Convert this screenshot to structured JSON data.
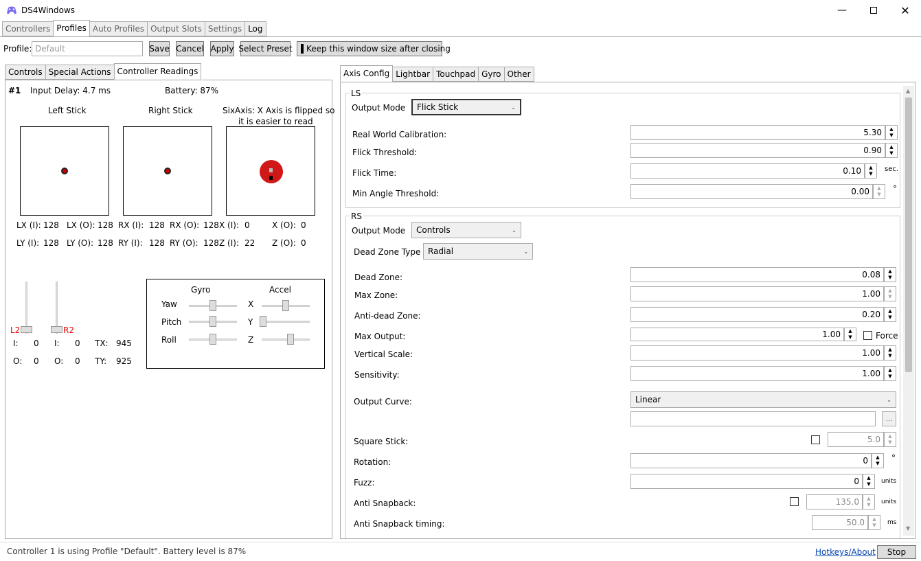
{
  "window": {
    "title": "DS4Windows",
    "min_icon": "minimize-icon",
    "max_icon": "maximize-icon",
    "close_icon": "close-icon"
  },
  "main_tabs": [
    "Controllers",
    "Profiles",
    "Auto Profiles",
    "Output Slots",
    "Settings",
    "Log"
  ],
  "toolbar": {
    "profile_label": "Profile:",
    "profile_placeholder": "Default",
    "save": "Save",
    "cancel": "Cancel",
    "apply": "Apply",
    "select_preset": "Select Preset",
    "keep_size": "Keep this window size after closing"
  },
  "left_tabs": [
    "Controls",
    "Special Actions",
    "Controller Readings"
  ],
  "readings": {
    "index": "#1",
    "input_delay": "Input Delay: 4.7 ms",
    "battery": "Battery: 87%",
    "left_stick": "Left Stick",
    "right_stick": "Right Stick",
    "sixaxis_1": "SixAxis: X Axis is flipped so",
    "sixaxis_2": "it is easier to read",
    "lx_i_label": "LX (I):",
    "lx_i": "128",
    "lx_o_label": "LX (O):",
    "lx_o": "128",
    "ly_i_label": "LY (I):",
    "ly_i": "128",
    "ly_o_label": "LY (O):",
    "ly_o": "128",
    "rx_i_label": "RX (I):",
    "rx_i": "128",
    "rx_o_label": "RX (O):",
    "rx_o": "128",
    "ry_i_label": "RY (I):",
    "ry_i": "128",
    "ry_o_label": "RY (O):",
    "ry_o": "128",
    "x_i_label": "X (I):",
    "x_i": "0",
    "x_o_label": "X (O):",
    "x_o": "0",
    "z_i_label": "Z (I):",
    "z_i": "22",
    "z_o_label": "Z (O):",
    "z_o": "0",
    "l2": "L2",
    "r2": "R2",
    "l2_i_label": "I:",
    "l2_i": "0",
    "l2_o_label": "O:",
    "l2_o": "0",
    "r2_i_label": "I:",
    "r2_i": "0",
    "r2_o_label": "O:",
    "r2_o": "0",
    "tx_label": "TX:",
    "tx": "945",
    "ty_label": "TY:",
    "ty": "925",
    "gyro": "Gyro",
    "accel": "Accel",
    "yaw": "Yaw",
    "pitch": "Pitch",
    "roll": "Roll",
    "ax": "X",
    "ay": "Y",
    "az": "Z"
  },
  "right_tabs": [
    "Axis Config",
    "Lightbar",
    "Touchpad",
    "Gyro",
    "Other"
  ],
  "ls": {
    "header": "LS",
    "output_mode_label": "Output Mode",
    "output_mode": "Flick Stick",
    "real_world_label": "Real World Calibration:",
    "real_world": "5.30",
    "flick_threshold_label": "Flick Threshold:",
    "flick_threshold": "0.90",
    "flick_time_label": "Flick Time:",
    "flick_time": "0.10",
    "flick_time_unit": "sec.",
    "min_angle_label": "Min Angle Threshold:",
    "min_angle": "0.00",
    "min_angle_unit": "°"
  },
  "rs": {
    "header": "RS",
    "output_mode_label": "Output Mode",
    "output_mode": "Controls",
    "dead_zone_type_label": "Dead Zone Type",
    "dead_zone_type": "Radial",
    "dead_zone_label": "Dead Zone:",
    "dead_zone": "0.08",
    "max_zone_label": "Max Zone:",
    "max_zone": "1.00",
    "anti_dead_label": "Anti-dead Zone:",
    "anti_dead": "0.20",
    "max_output_label": "Max Output:",
    "max_output": "1.00",
    "force_label": "Force",
    "vertical_scale_label": "Vertical Scale:",
    "vertical_scale": "1.00",
    "sensitivity_label": "Sensitivity:",
    "sensitivity": "1.00",
    "output_curve_label": "Output Curve:",
    "output_curve": "Linear",
    "curve_more": "...",
    "square_stick_label": "Square Stick:",
    "square_stick": "5.0",
    "rotation_label": "Rotation:",
    "rotation": "0",
    "rotation_unit": "°",
    "fuzz_label": "Fuzz:",
    "fuzz": "0",
    "fuzz_unit": "units",
    "anti_snap_label": "Anti Snapback:",
    "anti_snap": "135.0",
    "anti_snap_unit": "units",
    "anti_snap_timing_label": "Anti Snapback timing:",
    "anti_snap_timing": "50.0",
    "anti_snap_timing_unit": "ms"
  },
  "status": {
    "text": "Controller 1 is using Profile \"Default\". Battery level is 87%",
    "hotkeys": "Hotkeys/About",
    "stop": "Stop"
  }
}
